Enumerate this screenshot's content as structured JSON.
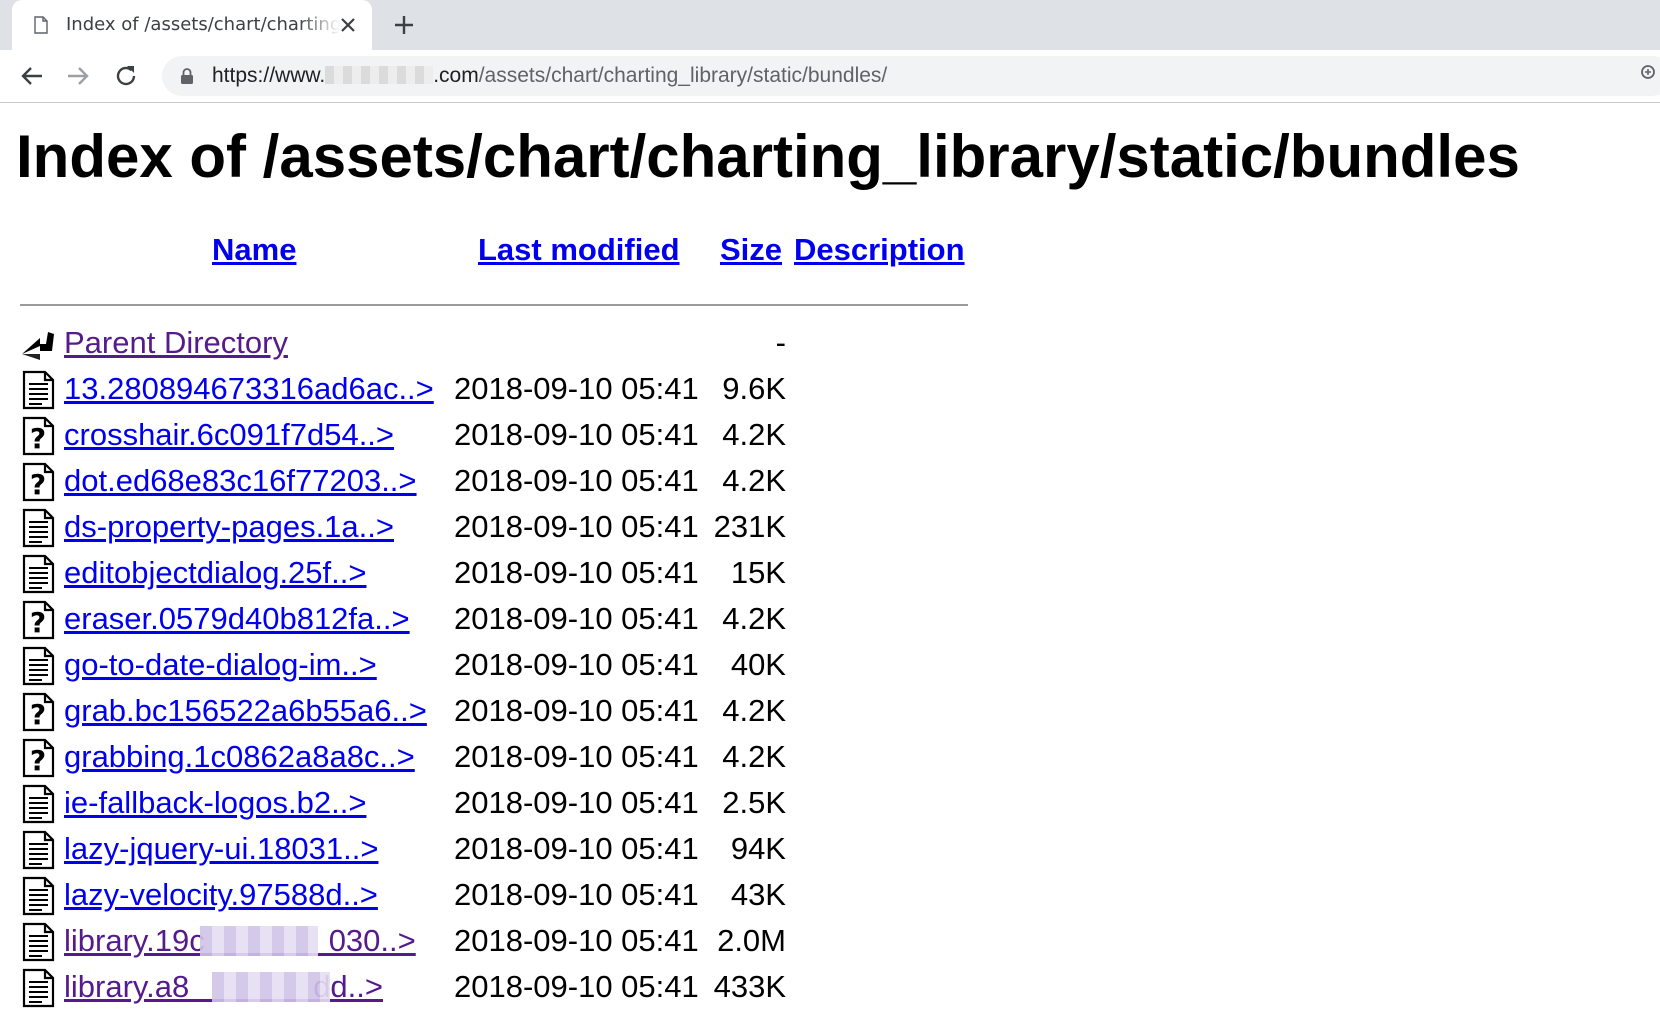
{
  "browser": {
    "tab_title": "Index of /assets/chart/charting_library/static/bundles",
    "url_scheme": "https://www.",
    "url_host_suffix": ".com",
    "url_path": "/assets/chart/charting_library/static/bundles/"
  },
  "page": {
    "title": "Index of /assets/chart/charting_library/static/bundles",
    "columns": {
      "name": "Name",
      "last_modified": "Last modified",
      "size": "Size",
      "description": "Description"
    },
    "rows": [
      {
        "icon": "back-icon",
        "name": "Parent Directory",
        "modified": "",
        "size": "-",
        "visited": true
      },
      {
        "icon": "text-file-icon",
        "name": "13.280894673316ad6ac..>",
        "modified": "2018-09-10 05:41",
        "size": "9.6K",
        "visited": false
      },
      {
        "icon": "unknown-file-icon",
        "name": "crosshair.6c091f7d54..>",
        "modified": "2018-09-10 05:41",
        "size": "4.2K",
        "visited": false
      },
      {
        "icon": "unknown-file-icon",
        "name": "dot.ed68e83c16f77203..>",
        "modified": "2018-09-10 05:41",
        "size": "4.2K",
        "visited": false
      },
      {
        "icon": "text-file-icon",
        "name": "ds-property-pages.1a..>",
        "modified": "2018-09-10 05:41",
        "size": "231K",
        "visited": false
      },
      {
        "icon": "text-file-icon",
        "name": "editobjectdialog.25f..>",
        "modified": "2018-09-10 05:41",
        "size": "15K",
        "visited": false
      },
      {
        "icon": "unknown-file-icon",
        "name": "eraser.0579d40b812fa..>",
        "modified": "2018-09-10 05:41",
        "size": "4.2K",
        "visited": false
      },
      {
        "icon": "text-file-icon",
        "name": "go-to-date-dialog-im..>",
        "modified": "2018-09-10 05:41",
        "size": "40K",
        "visited": false
      },
      {
        "icon": "unknown-file-icon",
        "name": "grab.bc156522a6b55a6..>",
        "modified": "2018-09-10 05:41",
        "size": "4.2K",
        "visited": false
      },
      {
        "icon": "unknown-file-icon",
        "name": "grabbing.1c0862a8a8c..>",
        "modified": "2018-09-10 05:41",
        "size": "4.2K",
        "visited": false
      },
      {
        "icon": "text-file-icon",
        "name": "ie-fallback-logos.b2..>",
        "modified": "2018-09-10 05:41",
        "size": "2.5K",
        "visited": false
      },
      {
        "icon": "text-file-icon",
        "name": "lazy-jquery-ui.18031..>",
        "modified": "2018-09-10 05:41",
        "size": "94K",
        "visited": false
      },
      {
        "icon": "text-file-icon",
        "name": "lazy-velocity.97588d..>",
        "modified": "2018-09-10 05:41",
        "size": "43K",
        "visited": false
      },
      {
        "icon": "text-file-icon",
        "name": "library.19c    030..>",
        "modified": "2018-09-10 05:41",
        "size": "2.0M",
        "visited": true
      },
      {
        "icon": "text-file-icon",
        "name": "library.a8    dd..>",
        "modified": "2018-09-10 05:41",
        "size": "433K",
        "visited": true
      }
    ]
  },
  "colors": {
    "link": "#0000ee",
    "visited_link": "#551a8b",
    "tabbar_bg": "#dee1e6",
    "omnibox_bg": "#f1f3f4"
  }
}
